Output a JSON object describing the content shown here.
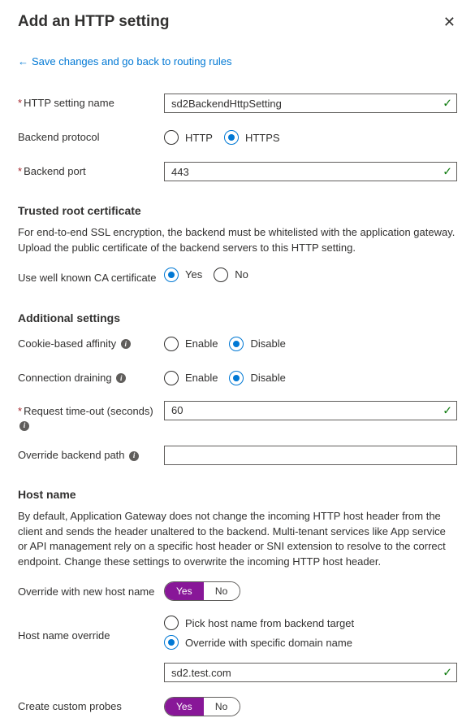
{
  "header": {
    "title": "Add an HTTP setting"
  },
  "backLink": "Save changes and go back to routing rules",
  "fields": {
    "httpSettingName": {
      "label": "HTTP setting name",
      "value": "sd2BackendHttpSetting"
    },
    "backendProtocol": {
      "label": "Backend protocol",
      "options": {
        "http": "HTTP",
        "https": "HTTPS"
      },
      "selected": "https"
    },
    "backendPort": {
      "label": "Backend port",
      "value": "443"
    }
  },
  "trusted": {
    "heading": "Trusted root certificate",
    "desc": "For end-to-end SSL encryption, the backend must be whitelisted with the application gateway. Upload the public certificate of the backend servers to this HTTP setting.",
    "useWellKnownCA": {
      "label": "Use well known CA certificate",
      "options": {
        "yes": "Yes",
        "no": "No"
      },
      "selected": "yes"
    }
  },
  "additional": {
    "heading": "Additional settings",
    "cookieAffinity": {
      "label": "Cookie-based affinity",
      "options": {
        "enable": "Enable",
        "disable": "Disable"
      },
      "selected": "disable"
    },
    "connectionDraining": {
      "label": "Connection draining",
      "options": {
        "enable": "Enable",
        "disable": "Disable"
      },
      "selected": "disable"
    },
    "requestTimeout": {
      "label": "Request time-out (seconds)",
      "value": "60"
    },
    "overrideBackendPath": {
      "label": "Override backend path",
      "value": ""
    }
  },
  "hostname": {
    "heading": "Host name",
    "desc": "By default, Application Gateway does not change the incoming HTTP host header from the client and sends the header unaltered to the backend. Multi-tenant services like App service or API management rely on a specific host header or SNI extension to resolve to the correct endpoint. Change these settings to overwrite the incoming HTTP host header.",
    "overrideNewHost": {
      "label": "Override with new host name",
      "options": {
        "yes": "Yes",
        "no": "No"
      },
      "selected": "yes"
    },
    "hostOverride": {
      "label": "Host name override",
      "options": {
        "pick": "Pick host name from backend target",
        "specific": "Override with specific domain name"
      },
      "selected": "specific",
      "value": "sd2.test.com"
    },
    "createCustomProbes": {
      "label": "Create custom probes",
      "options": {
        "yes": "Yes",
        "no": "No"
      },
      "selected": "yes"
    }
  }
}
